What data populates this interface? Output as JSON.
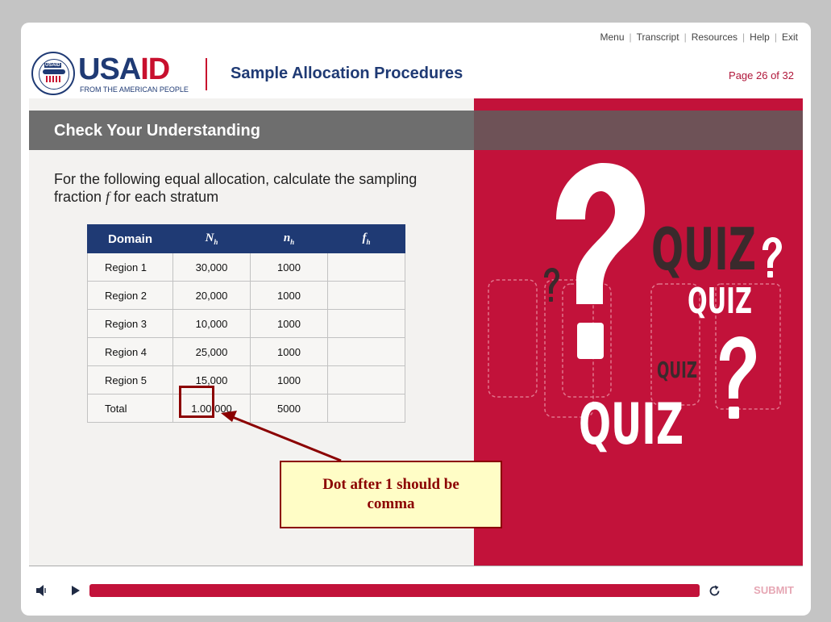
{
  "nav": {
    "items": [
      "Menu",
      "Transcript",
      "Resources",
      "Help",
      "Exit"
    ],
    "separator": "|"
  },
  "logo": {
    "seal_text": "USAID",
    "word_main": "USA",
    "word_accent": "ID",
    "tagline": "FROM THE AMERICAN PEOPLE"
  },
  "course_title": "Sample Allocation Procedures",
  "page_counter": "Page 26 of  32",
  "section_header": "Check Your Understanding",
  "prompt": {
    "text_before": "For the following equal allocation, calculate the sampling fraction ",
    "symbol": "f",
    "text_after": " for each stratum"
  },
  "table": {
    "headers": [
      {
        "main": "Domain",
        "sub": ""
      },
      {
        "main": "N",
        "sub": "h"
      },
      {
        "main": "n",
        "sub": "h"
      },
      {
        "main": "f",
        "sub": "h"
      }
    ],
    "rows": [
      [
        "Region 1",
        "30,000",
        "1000",
        ""
      ],
      [
        "Region 2",
        "20,000",
        "1000",
        ""
      ],
      [
        "Region 3",
        "10,000",
        "1000",
        ""
      ],
      [
        "Region 4",
        "25,000",
        "1000",
        ""
      ],
      [
        "Region 5",
        "15,000",
        "1000",
        ""
      ],
      [
        "Total",
        "1.00,000",
        "5000",
        ""
      ]
    ]
  },
  "annotation": {
    "callout_text": "Dot after 1 should be comma",
    "color": "#8b0000"
  },
  "quiz_graphic": {
    "words": [
      "QUIZ",
      "QUIZ",
      "QUIZ",
      "QUIZ"
    ],
    "mark": "?",
    "background": "#c2123a"
  },
  "controls": {
    "submit_label": "SUBMIT",
    "progress_fraction": 1.0
  },
  "colors": {
    "brand_blue": "#1f3a74",
    "brand_red": "#c8102e",
    "accent": "#c2123a"
  }
}
